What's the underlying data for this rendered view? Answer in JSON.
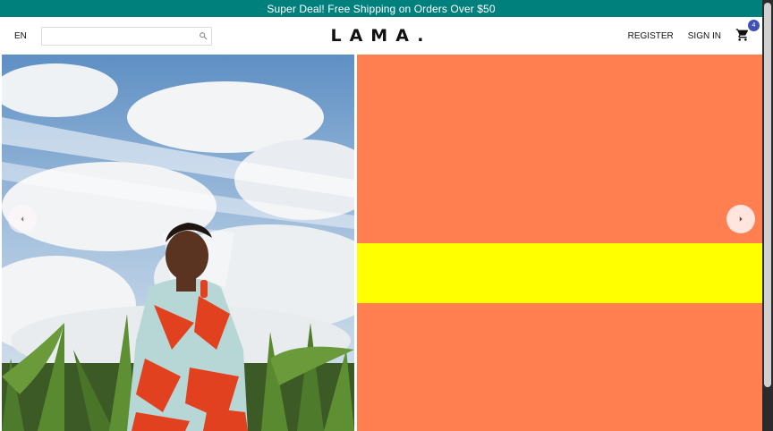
{
  "announcement": {
    "text": "Super Deal! Free Shipping on Orders Over $50"
  },
  "navbar": {
    "language": "EN",
    "search": {
      "placeholder": "",
      "value": ""
    },
    "logo": "LAMA.",
    "menu": {
      "register": "REGISTER",
      "sign_in": "SIGN IN"
    },
    "cart": {
      "count": "4",
      "icon": "shopping-cart-icon"
    }
  },
  "slider": {
    "slide_bg": "#ff7f50",
    "band_color": "#ffff00",
    "image": "woman-in-cornfield",
    "arrows": {
      "left_icon": "arrow-left-icon",
      "right_icon": "arrow-right-icon"
    }
  },
  "colors": {
    "announcement_bg": "#00807d",
    "badge": "#3f51b5"
  }
}
